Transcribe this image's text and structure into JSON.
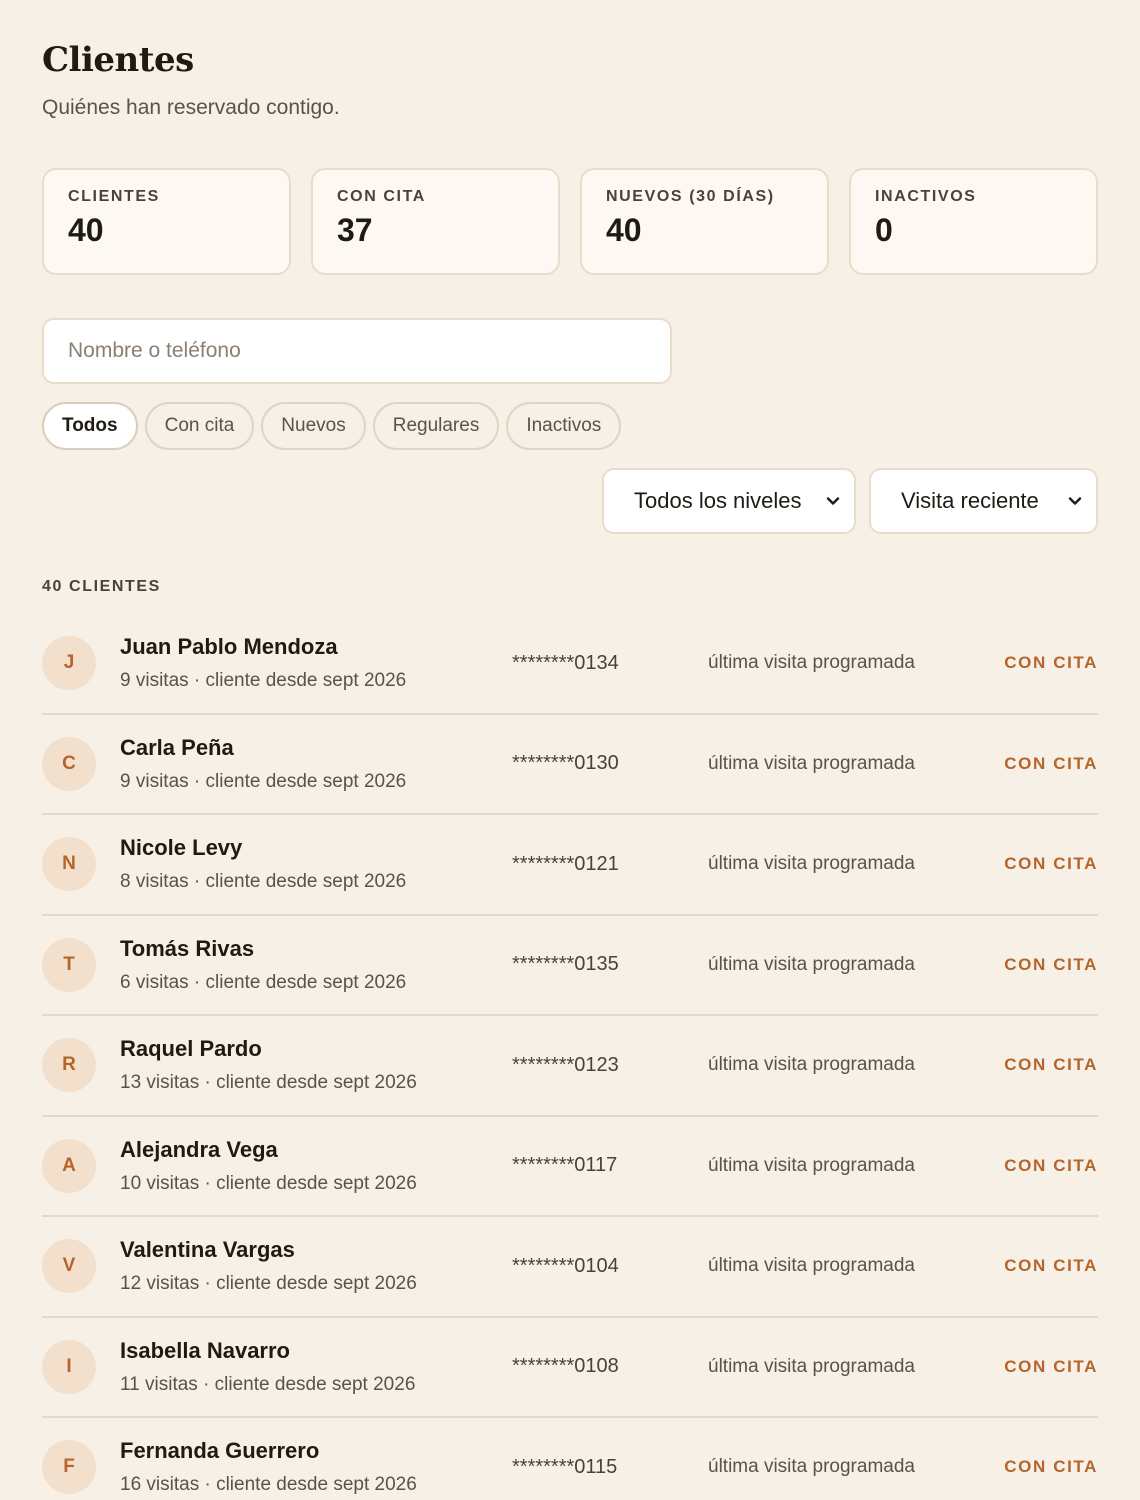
{
  "header": {
    "title": "Clientes",
    "subtitle": "Quiénes han reservado contigo."
  },
  "stats": [
    {
      "label": "CLIENTES",
      "value": "40"
    },
    {
      "label": "CON CITA",
      "value": "37"
    },
    {
      "label": "NUEVOS (30 DÍAS)",
      "value": "40"
    },
    {
      "label": "INACTIVOS",
      "value": "0"
    }
  ],
  "search": {
    "placeholder": "Nombre o teléfono",
    "value": ""
  },
  "filters": {
    "chips": [
      "Todos",
      "Con cita",
      "Nuevos",
      "Regulares",
      "Inactivos"
    ],
    "active": "Todos"
  },
  "selects": {
    "level": "Todos los niveles",
    "sort": "Visita reciente"
  },
  "list": {
    "count_label": "40 CLIENTES",
    "clients": [
      {
        "initial": "J",
        "name": "Juan Pablo Mendoza",
        "meta": "9 visitas · cliente desde sept 2026",
        "phone": "********0134",
        "last": "última visita programada",
        "status": "CON CITA"
      },
      {
        "initial": "C",
        "name": "Carla Peña",
        "meta": "9 visitas · cliente desde sept 2026",
        "phone": "********0130",
        "last": "última visita programada",
        "status": "CON CITA"
      },
      {
        "initial": "N",
        "name": "Nicole Levy",
        "meta": "8 visitas · cliente desde sept 2026",
        "phone": "********0121",
        "last": "última visita programada",
        "status": "CON CITA"
      },
      {
        "initial": "T",
        "name": "Tomás Rivas",
        "meta": "6 visitas · cliente desde sept 2026",
        "phone": "********0135",
        "last": "última visita programada",
        "status": "CON CITA"
      },
      {
        "initial": "R",
        "name": "Raquel Pardo",
        "meta": "13 visitas · cliente desde sept 2026",
        "phone": "********0123",
        "last": "última visita programada",
        "status": "CON CITA"
      },
      {
        "initial": "A",
        "name": "Alejandra Vega",
        "meta": "10 visitas · cliente desde sept 2026",
        "phone": "********0117",
        "last": "última visita programada",
        "status": "CON CITA"
      },
      {
        "initial": "V",
        "name": "Valentina Vargas",
        "meta": "12 visitas · cliente desde sept 2026",
        "phone": "********0104",
        "last": "última visita programada",
        "status": "CON CITA"
      },
      {
        "initial": "I",
        "name": "Isabella Navarro",
        "meta": "11 visitas · cliente desde sept 2026",
        "phone": "********0108",
        "last": "última visita programada",
        "status": "CON CITA"
      },
      {
        "initial": "F",
        "name": "Fernanda Guerrero",
        "meta": "16 visitas · cliente desde sept 2026",
        "phone": "********0115",
        "last": "última visita programada",
        "status": "CON CITA"
      }
    ]
  }
}
